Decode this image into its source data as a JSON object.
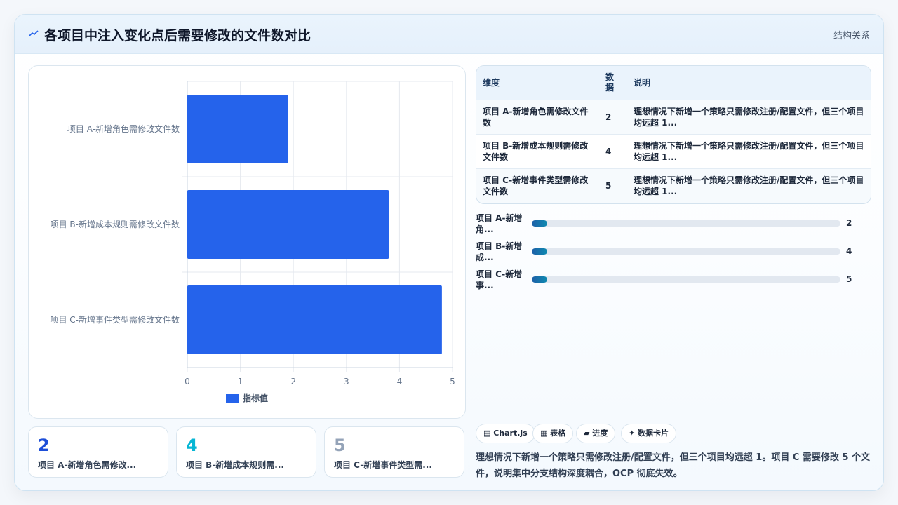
{
  "header": {
    "title": "各项目中注入变化点后需要修改的文件数对比",
    "relation_label": "结构关系"
  },
  "chart_data": {
    "type": "bar",
    "orientation": "horizontal",
    "categories": [
      "项目 A-新增角色需修改文件数",
      "项目 B-新增成本规则需修改文件数",
      "项目 C-新增事件类型需修改文件数"
    ],
    "series": [
      {
        "name": "指标值",
        "values": [
          1.9,
          3.8,
          4.8
        ]
      }
    ],
    "x_ticks": [
      "0",
      "1",
      "2",
      "3",
      "4",
      "5"
    ],
    "xlim": [
      0,
      5
    ],
    "grid": true,
    "legend": "bottom",
    "bar_color": "#2563eb"
  },
  "kpis": [
    {
      "value": "2",
      "label": "项目 A-新增角色需修改...",
      "color": "#1d4ed8"
    },
    {
      "value": "4",
      "label": "项目 B-新增成本规则需...",
      "color": "#06b6d4"
    },
    {
      "value": "5",
      "label": "项目 C-新增事件类型需...",
      "color": "#94a3b8"
    }
  ],
  "table": {
    "headers": [
      "维度",
      "数据",
      "说明"
    ],
    "rows": [
      {
        "dim": "项目 A-新增角色需修改文件数",
        "val": "2",
        "desc": "理想情况下新增一个策略只需修改注册/配置文件，但三个项目均远超 1..."
      },
      {
        "dim": "项目 B-新增成本规则需修改文件数",
        "val": "4",
        "desc": "理想情况下新增一个策略只需修改注册/配置文件，但三个项目均远超 1..."
      },
      {
        "dim": "项目 C-新增事件类型需修改文件数",
        "val": "5",
        "desc": "理想情况下新增一个策略只需修改注册/配置文件，但三个项目均远超 1..."
      }
    ]
  },
  "progress": [
    {
      "label": "项目 A-新增角...",
      "value": "2",
      "fill": 0.05
    },
    {
      "label": "项目 B-新增成...",
      "value": "4",
      "fill": 0.05
    },
    {
      "label": "项目 C-新增事...",
      "value": "5",
      "fill": 0.05
    }
  ],
  "chips": [
    "▤ Chart.js",
    "▦ 表格",
    "▰ 进度",
    "✦ 数据卡片"
  ],
  "summary": "理想情况下新增一个策略只需修改注册/配置文件，但三个项目均远超 1。项目 C 需要修改 5 个文件，说明集中分支结构深度耦合，OCP 彻底失效。"
}
